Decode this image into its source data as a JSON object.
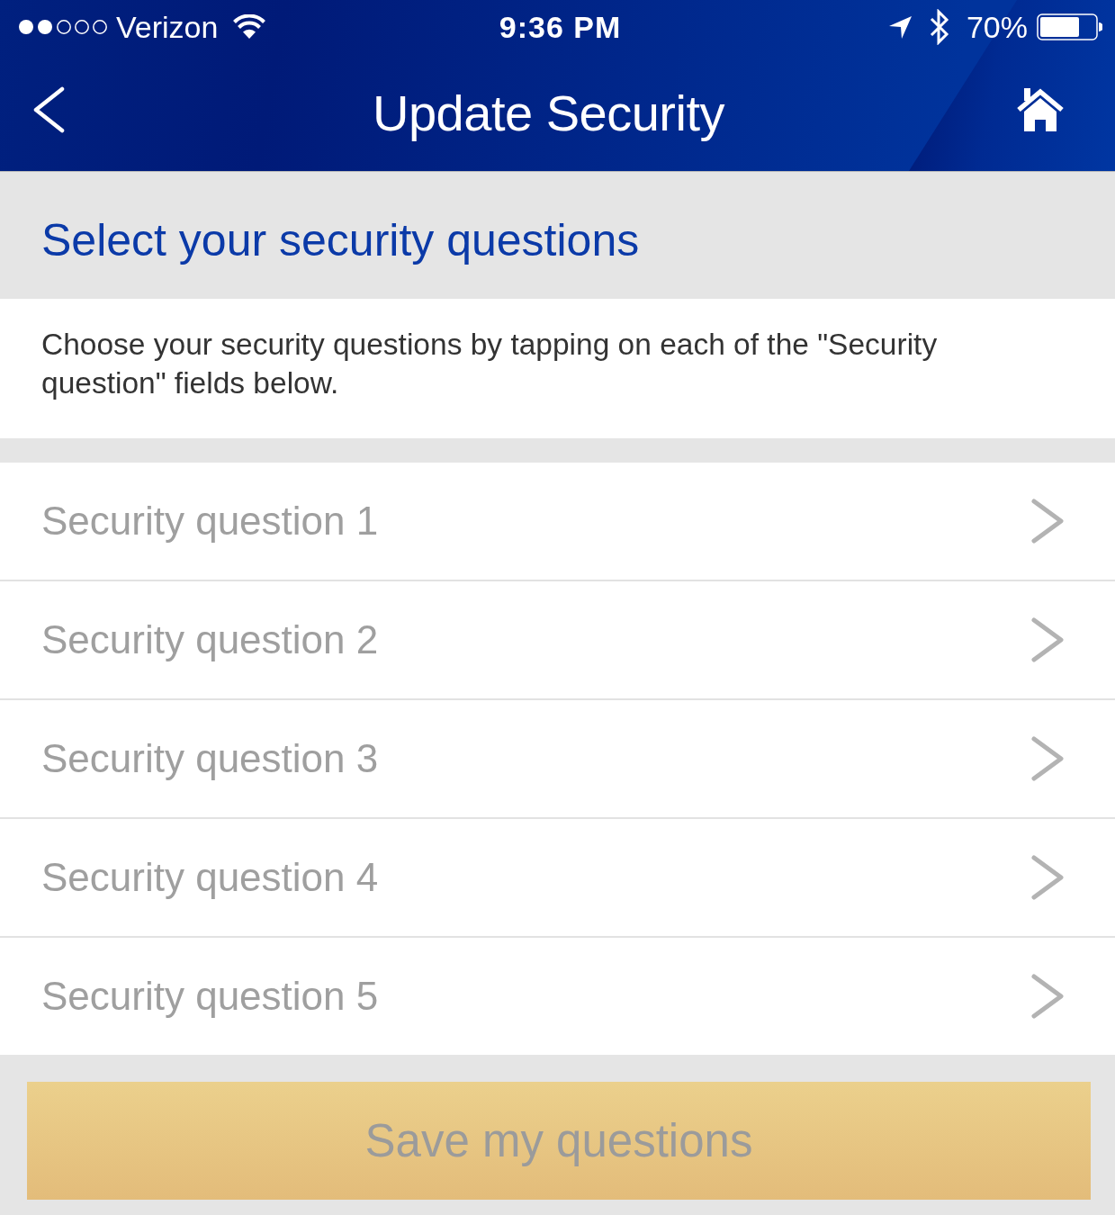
{
  "status_bar": {
    "carrier": "Verizon",
    "time": "9:36 PM",
    "battery_text": "70%"
  },
  "nav_bar": {
    "title": "Update Security"
  },
  "section": {
    "heading": "Select your security questions",
    "description": "Choose your security questions by tapping on each of the \"Security question\" fields below."
  },
  "questions": [
    {
      "label": "Security question 1"
    },
    {
      "label": "Security question 2"
    },
    {
      "label": "Security question 3"
    },
    {
      "label": "Security question 4"
    },
    {
      "label": "Security question 5"
    }
  ],
  "save_button": {
    "label": "Save my questions",
    "disabled": true
  }
}
